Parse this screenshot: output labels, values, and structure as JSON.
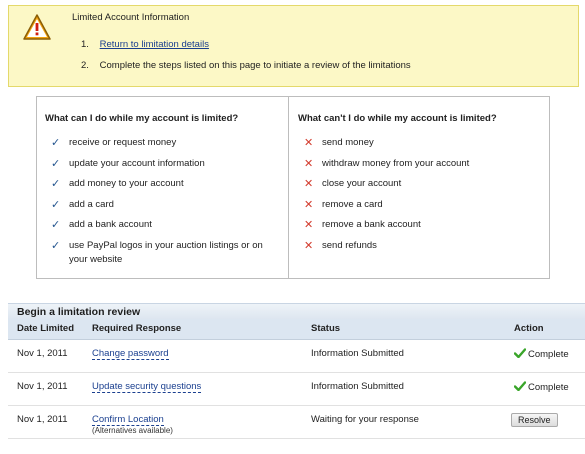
{
  "warning": {
    "title": "Limited Account Information",
    "items": [
      {
        "num": "1.",
        "text": "Return to limitation details",
        "is_link": true
      },
      {
        "num": "2.",
        "text": "Complete the steps listed on this page to initiate a review of the limitations",
        "is_link": false
      }
    ]
  },
  "limits": {
    "can": {
      "heading": "What can I do while my account is limited?",
      "items": [
        "receive or request money",
        "update your account information",
        "add money to your account",
        "add a card",
        "add a bank account",
        "use PayPal logos in your auction listings or on your website"
      ]
    },
    "cannot": {
      "heading": "What can't I do while my account is limited?",
      "items": [
        "send money",
        "withdraw money from your account",
        "close your account",
        "remove a card",
        "remove a bank account",
        "send refunds"
      ]
    }
  },
  "review": {
    "title": "Begin a limitation review",
    "columns": [
      "Date Limited",
      "Required Response",
      "Status",
      "Action"
    ],
    "rows": [
      {
        "date": "Nov 1, 2011",
        "response": "Change password",
        "note": "",
        "status": "Information Submitted",
        "action": "Complete"
      },
      {
        "date": "Nov 1, 2011",
        "response": "Update security questions",
        "note": "",
        "status": "Information Submitted",
        "action": "Complete"
      },
      {
        "date": "Nov 1, 2011",
        "response": "Confirm Location",
        "note": "(Alternatives available)",
        "status": "Waiting for your response",
        "action": "Resolve"
      }
    ]
  },
  "colors": {
    "warning_bg": "#fcf8c6",
    "link": "#1a3f8f",
    "check": "#24558f",
    "cross": "#d23a2c",
    "complete_check": "#3aa52a"
  },
  "icons": {
    "warning": "warning-triangle-icon",
    "can": "checkmark-icon",
    "cannot": "cross-icon",
    "complete": "green-check-icon"
  }
}
